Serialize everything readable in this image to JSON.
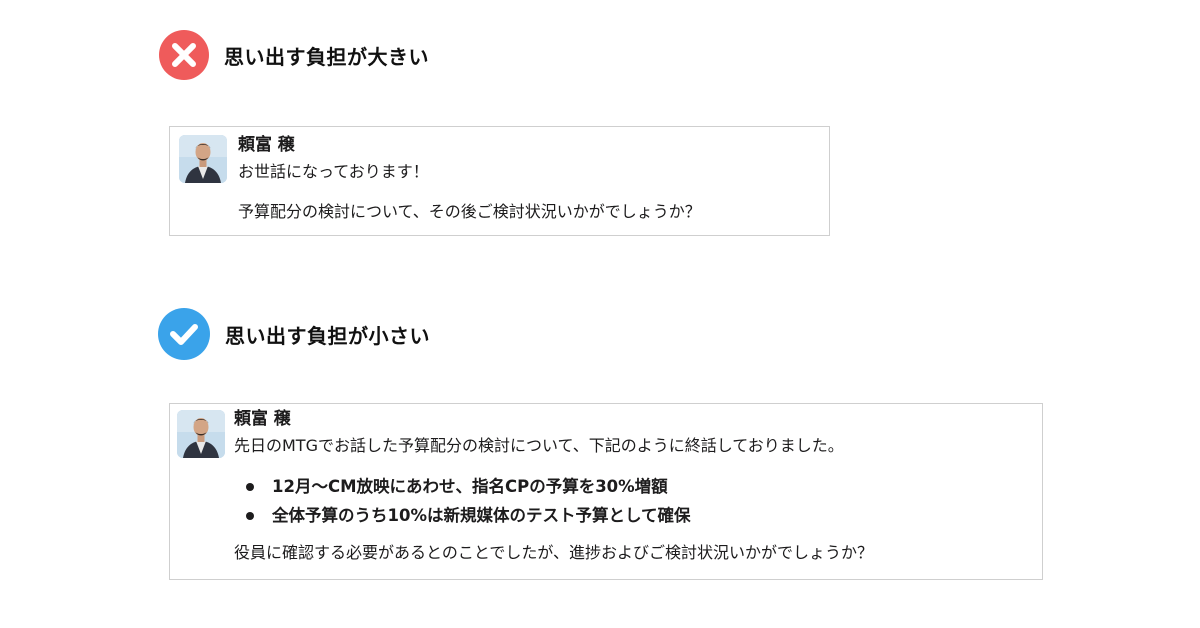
{
  "bad_example": {
    "heading": "思い出す負担が大きい",
    "icon": "x-circle-icon",
    "icon_color": "#ef5b5b",
    "message": {
      "sender": "頼富 穣",
      "line1": "お世話になっております！",
      "line2": "予算配分の検討について、その後ご検討状況いかがでしょうか？"
    }
  },
  "good_example": {
    "heading": "思い出す負担が小さい",
    "icon": "check-circle-icon",
    "icon_color": "#3aa3ea",
    "message": {
      "sender": "頼富 穣",
      "line1": "先日のMTGでお話した予算配分の検討について、下記のように終話しておりました。",
      "bullets": [
        "12月〜CM放映にあわせ、指名CPの予算を30%増額",
        "全体予算のうち10%は新規媒体のテスト予算として確保"
      ],
      "line_last": "役員に確認する必要があるとのことでしたが、進捗およびご検討状況いかがでしょうか？"
    }
  }
}
